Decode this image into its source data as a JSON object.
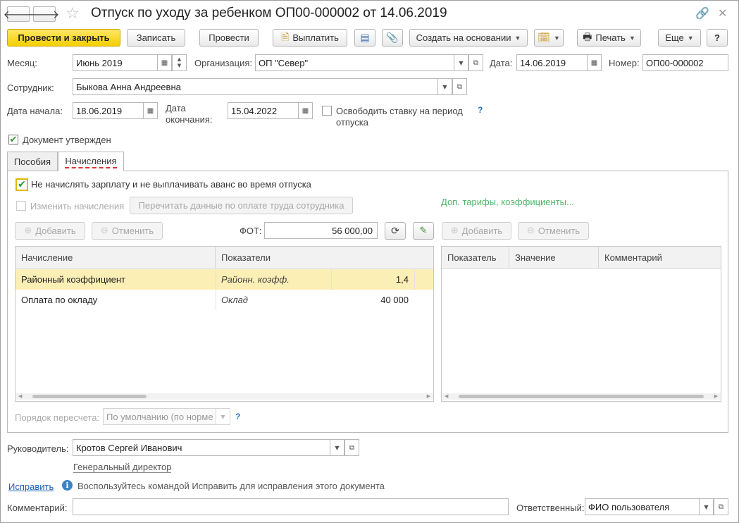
{
  "window": {
    "title": "Отпуск по уходу за ребенком ОП00-000002 от 14.06.2019",
    "back_icon": "arrow-left-icon",
    "forward_icon": "arrow-right-icon",
    "favorite_icon": "star-icon",
    "link_icon": "link-icon",
    "close_icon": "close-icon"
  },
  "toolbar": {
    "post_close": "Провести и закрыть",
    "save": "Записать",
    "post": "Провести",
    "pay": "Выплатить",
    "create_based": "Создать на основании",
    "print": "Печать",
    "more": "Еще",
    "help": "?"
  },
  "header": {
    "month_label": "Месяц:",
    "month_value": "Июнь 2019",
    "org_label": "Организация:",
    "org_value": "ОП \"Север\"",
    "date_label": "Дата:",
    "date_value": "14.06.2019",
    "number_label": "Номер:",
    "number_value": "ОП00-000002",
    "employee_label": "Сотрудник:",
    "employee_value": "Быкова Анна Андреевна",
    "start_label": "Дата начала:",
    "start_value": "18.06.2019",
    "end_label_1": "Дата",
    "end_label_2": "окончания:",
    "end_value": "15.04.2022",
    "free_rate_label_1": "Освободить ставку на период",
    "free_rate_label_2": "отпуска",
    "free_rate_checked": false,
    "help": "?",
    "approved_label": "Документ утвержден",
    "approved_checked": true
  },
  "tabs": [
    {
      "label": "Пособия",
      "active": false
    },
    {
      "label": "Начисления",
      "active": true
    }
  ],
  "accruals": {
    "no_salary_label": "Не начислять зарплату и не выплачивать аванс во время отпуска",
    "no_salary_checked": true,
    "change_label": "Изменить начисления",
    "change_checked": false,
    "reread_button": "Перечитать данные по оплате труда сотрудника",
    "extra_link": "Доп. тарифы, коэффициенты...",
    "add": "Добавить",
    "cancel": "Отменить",
    "fot_label": "ФОТ:",
    "fot_value": "56 000,00",
    "left_columns": [
      "Начисление",
      "Показатели"
    ],
    "rows": [
      {
        "name": "Районный коэффициент",
        "indicator": "Районн. коэфф.",
        "value": "1,4",
        "selected": true
      },
      {
        "name": "Оплата по окладу",
        "indicator": "Оклад",
        "value": "40 000",
        "selected": false
      }
    ],
    "right_add": "Добавить",
    "right_cancel": "Отменить",
    "right_columns": [
      "Показатель",
      "Значение",
      "Комментарий"
    ],
    "recalc_label": "Порядок пересчета:",
    "recalc_value": "По умолчанию (по норме",
    "recalc_help": "?"
  },
  "footer": {
    "manager_label": "Руководитель:",
    "manager_value": "Кротов Сергей Иванович",
    "manager_position": "Генеральный директор",
    "fix_link": "Исправить",
    "fix_hint": "Воспользуйтесь командой Исправить для исправления этого документа",
    "comment_label": "Комментарий:",
    "comment_value": "",
    "responsible_label": "Ответственный:",
    "responsible_value": "ФИО пользователя"
  }
}
